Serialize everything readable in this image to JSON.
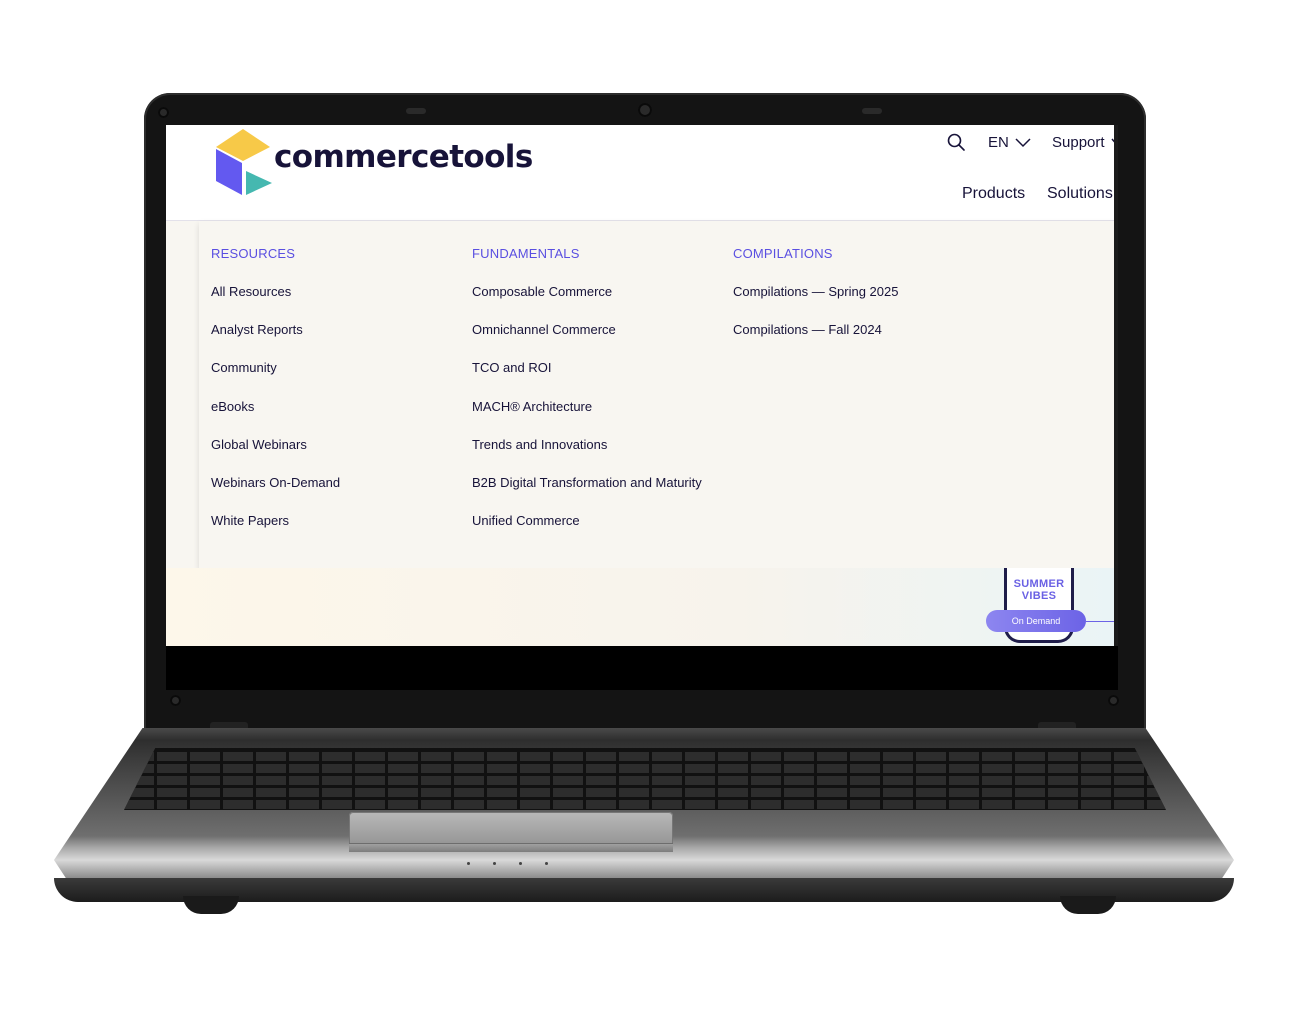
{
  "brand": {
    "name": "commercetools"
  },
  "header": {
    "language": "EN",
    "support_label": "Support",
    "nav": [
      "Products",
      "Solutions"
    ]
  },
  "menu": {
    "columns": [
      {
        "title": "RESOURCES",
        "items": [
          "All Resources",
          "Analyst Reports",
          "Community",
          "eBooks",
          "Global Webinars",
          "Webinars On-Demand",
          "White Papers"
        ]
      },
      {
        "title": "FUNDAMENTALS",
        "items": [
          "Composable Commerce",
          "Omnichannel Commerce",
          "TCO and ROI",
          "MACH® Architecture",
          "Trends and Innovations",
          "B2B Digital Transformation and Maturity",
          "Unified Commerce"
        ]
      },
      {
        "title": "COMPILATIONS",
        "items": [
          "Compilations — Spring 2025",
          "Compilations — Fall 2024"
        ]
      }
    ]
  },
  "promo": {
    "title_line1": "SUMMER",
    "title_line2": "VIBES",
    "button": "On Demand"
  },
  "colors": {
    "accent": "#5a4fe1",
    "text": "#171339",
    "logo_yellow": "#f7c948",
    "logo_purple": "#6359f0",
    "logo_teal": "#45b8b0"
  },
  "icons": [
    "search-icon",
    "chevron-down-icon",
    "logo-cube-icon"
  ]
}
